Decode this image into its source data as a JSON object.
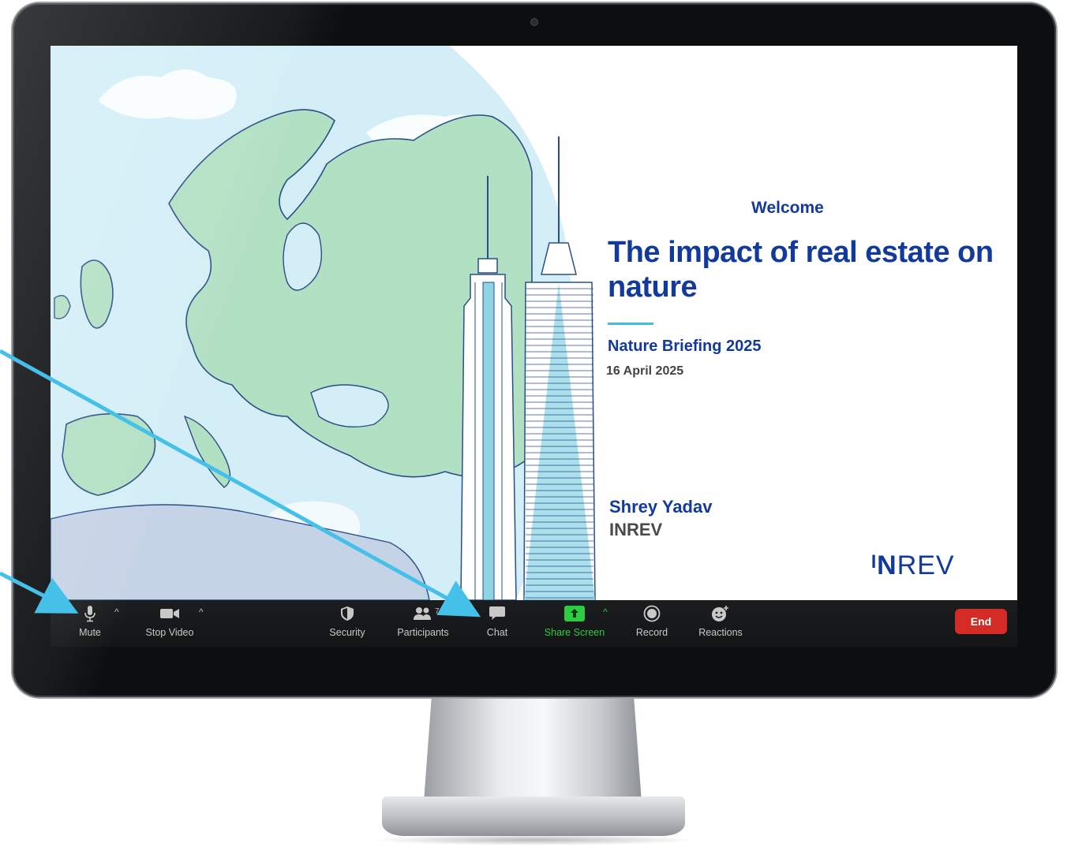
{
  "slide": {
    "welcome": "Welcome",
    "title": "The impact of real estate on nature",
    "subtitle": "Nature Briefing 2025",
    "date": "16 April 2025",
    "presenter": "Shrey Yadav",
    "organization": "INREV",
    "logo_mark": "ᴵN",
    "logo_rest": "REV",
    "colors": {
      "brand": "#123a9c",
      "accent": "#3dbfe0",
      "land": "#b2e0c3",
      "sea": "#d3eef7"
    }
  },
  "toolbar": {
    "mute": {
      "label": "Mute",
      "icon": "microphone-icon"
    },
    "stop_video": {
      "label": "Stop Video",
      "icon": "video-camera-icon"
    },
    "security": {
      "label": "Security",
      "icon": "shield-icon"
    },
    "participants": {
      "label": "Participants",
      "count": "7",
      "icon": "people-icon"
    },
    "chat": {
      "label": "Chat",
      "icon": "chat-bubble-icon"
    },
    "share_screen": {
      "label": "Share Screen",
      "icon": "share-arrow-icon",
      "color": "#2ecc40"
    },
    "record": {
      "label": "Record",
      "icon": "record-icon"
    },
    "reactions": {
      "label": "Reactions",
      "icon": "smiley-plus-icon"
    },
    "end": {
      "label": "End",
      "color": "#d42b26"
    },
    "caret": "^"
  },
  "annotations": {
    "arrow_color": "#45c0e8"
  }
}
